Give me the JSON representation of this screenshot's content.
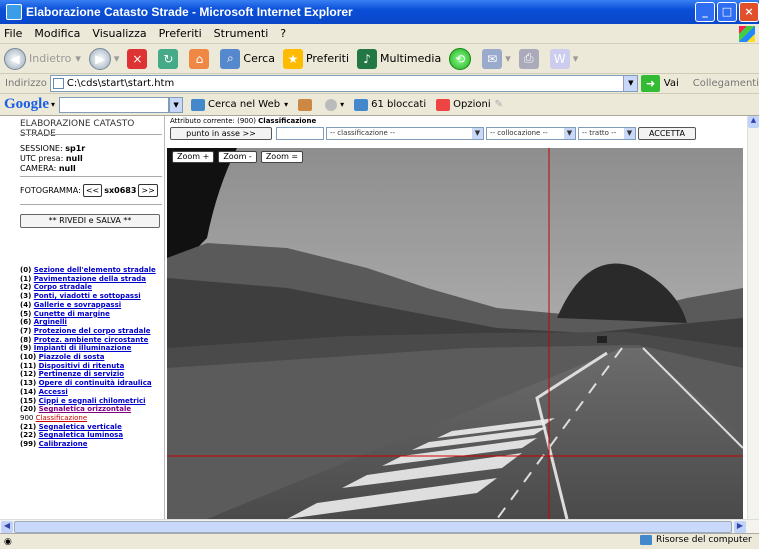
{
  "window": {
    "title": "Elaborazione Catasto Strade - Microsoft Internet Explorer"
  },
  "menu": [
    "File",
    "Modifica",
    "Visualizza",
    "Preferiti",
    "Strumenti",
    "?"
  ],
  "toolbar": {
    "back": "Indietro",
    "search": "Cerca",
    "favorites": "Preferiti",
    "media": "Multimedia"
  },
  "address": {
    "label": "Indirizzo",
    "value": "C:\\cds\\start\\start.htm",
    "go": "Vai",
    "links": "Collegamenti"
  },
  "google": {
    "logo": "Google",
    "search_web": "Cerca nel Web",
    "blocked": "61 bloccati",
    "options": "Opzioni"
  },
  "app": {
    "title": "ELABORAZIONE CATASTO STRADE",
    "session_label": "SESSIONE:",
    "session_value": "sp1r",
    "utc_label": "UTC presa:",
    "utc_value": "null",
    "camera_label": "CAMERA:",
    "camera_value": "null",
    "frame_label": "FOTOGRAMMA:",
    "prev": "<<",
    "frame_value": "sx0683",
    "next": ">>",
    "review_save": "** RIVEDI e SALVA **",
    "attr_label": "Attributo corrente: (900)",
    "attr_value": "Classificazione",
    "axis_button": "punto in asse >>",
    "sel_class": "-- classificazione --",
    "sel_place": "-- collocazione --",
    "sel_trait": "-- tratto --",
    "accept": "ACCETTA",
    "zoom_in": "Zoom +",
    "zoom_out": "Zoom -",
    "zoom_reset": "Zoom ="
  },
  "categories": [
    {
      "code": "(0)",
      "label": "Sezione dell'elemento stradale"
    },
    {
      "code": "(1)",
      "label": "Pavimentazione della strada"
    },
    {
      "code": "(2)",
      "label": "Corpo stradale"
    },
    {
      "code": "(3)",
      "label": "Ponti, viadotti e sottopassi"
    },
    {
      "code": "(4)",
      "label": "Gallerie e sovrappassi"
    },
    {
      "code": "(5)",
      "label": "Cunette di margine"
    },
    {
      "code": "(6)",
      "label": "Arginelli"
    },
    {
      "code": "(7)",
      "label": "Protezione del corpo stradale"
    },
    {
      "code": "(8)",
      "label": "Protez. ambiente circostante"
    },
    {
      "code": "(9)",
      "label": "Impianti di illuminazione"
    },
    {
      "code": "(10)",
      "label": "Piazzole di sosta"
    },
    {
      "code": "(11)",
      "label": "Dispositivi di ritenuta"
    },
    {
      "code": "(12)",
      "label": "Pertinenze di servizio"
    },
    {
      "code": "(13)",
      "label": "Opere di continuità idraulica"
    },
    {
      "code": "(14)",
      "label": "Accessi"
    },
    {
      "code": "(15)",
      "label": "Cippi e segnali chilometrici"
    },
    {
      "code": "(20)",
      "label": "Segnaletica orizzontale"
    },
    {
      "code": "900",
      "label": "Classificazione"
    },
    {
      "code": "(21)",
      "label": "Segnaletica verticale"
    },
    {
      "code": "(22)",
      "label": "Segnaletica luminosa"
    },
    {
      "code": "(99)",
      "label": "Calibrazione"
    }
  ],
  "status": {
    "zone": "Risorse del computer"
  }
}
